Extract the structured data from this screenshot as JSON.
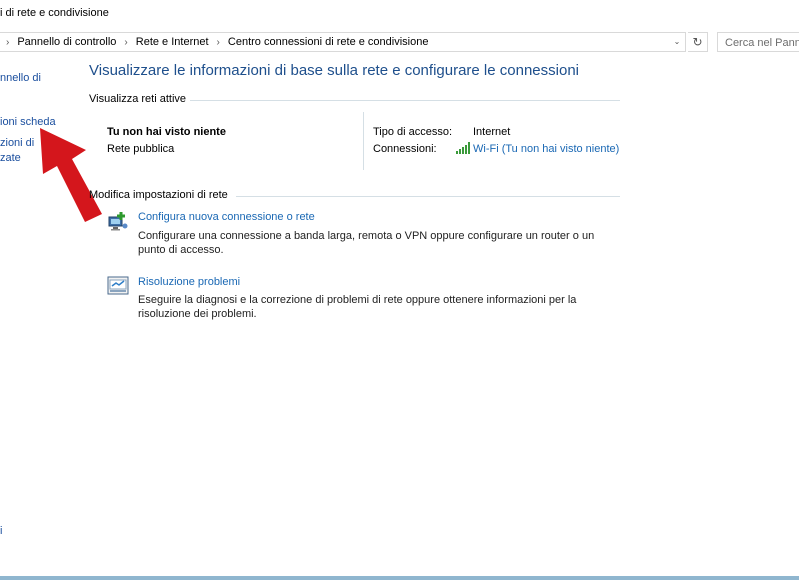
{
  "window": {
    "title": "i di rete e condivisione"
  },
  "address": {
    "breadcrumbs": [
      "Pannello di controllo",
      "Rete e Internet",
      "Centro connessioni di rete e condivisione"
    ],
    "search_placeholder": "Cerca nel Pann"
  },
  "sidebar": {
    "items": [
      "nnello di",
      "ioni scheda",
      "zioni di",
      "zate"
    ],
    "bottom": "i"
  },
  "main": {
    "heading": "Visualizzare le informazioni di base sulla rete e configurare le connessioni",
    "active_networks": {
      "header": "Visualizza reti attive",
      "network_name": "Tu non hai visto niente",
      "network_type": "Rete pubblica",
      "access_type_label": "Tipo di accesso:",
      "access_type_value": "Internet",
      "connections_label": "Connessioni:",
      "connections_value": "Wi-Fi (Tu non hai visto niente)"
    },
    "change_settings": {
      "header": "Modifica impostazioni di rete",
      "tasks": [
        {
          "title": "Configura nuova connessione o rete",
          "description": "Configurare una connessione a banda larga, remota o VPN oppure configurare un router o un punto di accesso.",
          "icon": "network-setup-icon"
        },
        {
          "title": "Risoluzione problemi",
          "description": "Eseguire la diagnosi e la correzione di problemi di rete oppure ottenere informazioni per la risoluzione dei problemi.",
          "icon": "troubleshoot-icon"
        }
      ]
    }
  },
  "colors": {
    "heading": "#1e4f8c",
    "link": "#1a68b4",
    "arrow": "#d4161c"
  }
}
